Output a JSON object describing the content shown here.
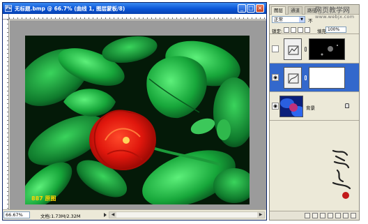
{
  "document": {
    "title": "无标题.bmp @ 66.7% (曲线 1, 图层蒙板/8)",
    "app_icon": "Ps",
    "window_buttons": [
      "_",
      "□",
      "×"
    ],
    "photo_caption": "887 原图",
    "status": {
      "zoom": "66.67%",
      "info": "文档:1.73M/2.32M"
    }
  },
  "panel": {
    "tabs": [
      "图层",
      "通道",
      "路径"
    ],
    "blend_mode": "正常",
    "opacity_label": "不",
    "lock_label": "锁定:",
    "fill_label": "填充:",
    "fill_value": "100%",
    "layers": [
      {
        "name": "",
        "visible": false,
        "selected": false,
        "type": "adjustment-dark"
      },
      {
        "name": "",
        "visible": true,
        "selected": true,
        "type": "curves-mask"
      },
      {
        "name": "背景",
        "visible": true,
        "selected": false,
        "type": "background"
      }
    ]
  },
  "watermark": {
    "site": "网页教学网",
    "url": "www.webjx.com"
  },
  "colors": {
    "titlebar": "#0a54d6",
    "selected_layer": "#3368cc",
    "canvas_bg": "#9b9b9b",
    "caption": "#ffd400"
  }
}
